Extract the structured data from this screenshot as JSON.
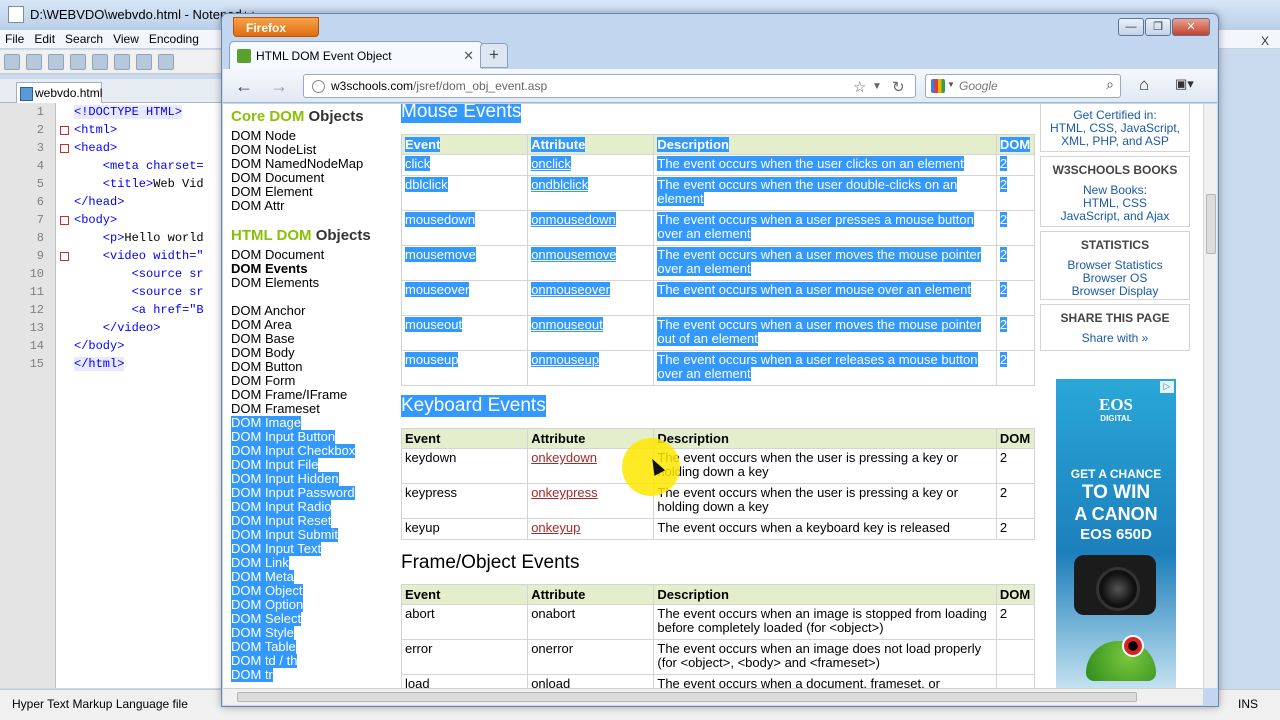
{
  "npp": {
    "title": "D:\\WEBVDO\\webvdo.html - Notepad++",
    "menu": [
      "File",
      "Edit",
      "Search",
      "View",
      "Encoding"
    ],
    "menu_close": "X",
    "tab": "webvdo.html",
    "lines": [
      {
        "n": "1",
        "code": "<!DOCTYPE HTML>",
        "text": ""
      },
      {
        "n": "2",
        "code": "<html>",
        "text": ""
      },
      {
        "n": "3",
        "code": "<head>",
        "text": ""
      },
      {
        "n": "4",
        "code": "    <meta charset=",
        "text": ""
      },
      {
        "n": "5",
        "code": "    <title>",
        "text": "Web Vid"
      },
      {
        "n": "6",
        "code": "</head>",
        "text": ""
      },
      {
        "n": "7",
        "code": "<body>",
        "text": ""
      },
      {
        "n": "8",
        "code": "    <p>",
        "text": "Hello world"
      },
      {
        "n": "9",
        "code": "    <video width=\"",
        "text": ""
      },
      {
        "n": "10",
        "code": "        <source sr",
        "text": ""
      },
      {
        "n": "11",
        "code": "        <source sr",
        "text": ""
      },
      {
        "n": "12",
        "code": "        <a href=\"B",
        "text": ""
      },
      {
        "n": "13",
        "code": "    </video>",
        "text": ""
      },
      {
        "n": "14",
        "code": "</body>",
        "text": ""
      },
      {
        "n": "15",
        "code": "</html>",
        "text": ""
      }
    ],
    "status_left": "Hyper Text Markup Language file",
    "status_right": "INS"
  },
  "ff": {
    "menu_button": "Firefox",
    "tab_title": "HTML DOM Event Object",
    "tab_close": "✕",
    "new_tab": "+",
    "url_domain": "w3schools.com",
    "url_path": "/jsref/dom_obj_event.asp",
    "search_placeholder": "Google"
  },
  "sidebar": {
    "core_em": "Core DOM",
    "core_rest": " Objects",
    "core_items": [
      "DOM Node",
      "DOM NodeList",
      "DOM NamedNodeMap",
      "DOM Document",
      "DOM Element",
      "DOM Attr"
    ],
    "html_em": "HTML DOM",
    "html_rest": " Objects",
    "html_items": [
      {
        "label": "DOM Document",
        "sel": false,
        "bold": false
      },
      {
        "label": "DOM Events",
        "sel": false,
        "bold": true
      },
      {
        "label": "DOM Elements",
        "sel": false,
        "bold": false
      }
    ],
    "obj_items": [
      {
        "label": "DOM Anchor",
        "sel": false
      },
      {
        "label": "DOM Area",
        "sel": false
      },
      {
        "label": "DOM Base",
        "sel": false
      },
      {
        "label": "DOM Body",
        "sel": false
      },
      {
        "label": "DOM Button",
        "sel": false
      },
      {
        "label": "DOM Form",
        "sel": false
      },
      {
        "label": "DOM Frame/IFrame",
        "sel": false
      },
      {
        "label": "DOM Frameset",
        "sel": false
      },
      {
        "label": "DOM Image",
        "sel": true
      },
      {
        "label": "DOM Input Button",
        "sel": true
      },
      {
        "label": "DOM Input Checkbox",
        "sel": true
      },
      {
        "label": "DOM Input File",
        "sel": true
      },
      {
        "label": "DOM Input Hidden",
        "sel": true
      },
      {
        "label": "DOM Input Password",
        "sel": true
      },
      {
        "label": "DOM Input Radio",
        "sel": true
      },
      {
        "label": "DOM Input Reset",
        "sel": true
      },
      {
        "label": "DOM Input Submit",
        "sel": true
      },
      {
        "label": "DOM Input Text",
        "sel": true
      },
      {
        "label": "DOM Link",
        "sel": true
      },
      {
        "label": "DOM Meta",
        "sel": true
      },
      {
        "label": "DOM Object",
        "sel": true
      },
      {
        "label": "DOM Option",
        "sel": true
      },
      {
        "label": "DOM Select",
        "sel": true
      },
      {
        "label": "DOM Style",
        "sel": true
      },
      {
        "label": "DOM Table",
        "sel": true
      },
      {
        "label": "DOM td / th",
        "sel": true
      },
      {
        "label": "DOM tr",
        "sel": true
      }
    ]
  },
  "headers": [
    "Event",
    "Attribute",
    "Description",
    "DOM"
  ],
  "mouse": {
    "title": "Mouse Events",
    "rows": [
      [
        "click",
        "onclick",
        "The event occurs when the user clicks on an element",
        "2"
      ],
      [
        "dblclick",
        "ondblclick",
        "The event occurs when the user double-clicks on an element",
        "2"
      ],
      [
        "mousedown",
        "onmousedown",
        "The event occurs when a user presses a mouse button over an element",
        "2"
      ],
      [
        "mousemove",
        "onmousemove",
        "The event occurs when a user moves the mouse pointer over an element",
        "2"
      ],
      [
        "mouseover",
        "onmouseover",
        "The event occurs when a user mouse over an element",
        "2"
      ],
      [
        "mouseout",
        "onmouseout",
        "The event occurs when a user moves the mouse pointer out of an element",
        "2"
      ],
      [
        "mouseup",
        "onmouseup",
        "The event occurs when a user releases a mouse button over an element",
        "2"
      ]
    ]
  },
  "keyboard": {
    "title": "Keyboard Events",
    "rows": [
      [
        "keydown",
        "onkeydown",
        "The event occurs when the user is pressing a key or holding down a key",
        "2"
      ],
      [
        "keypress",
        "onkeypress",
        "The event occurs when the user is pressing a key or holding down a key",
        "2"
      ],
      [
        "keyup",
        "onkeyup",
        "The event occurs when a keyboard key is released",
        "2"
      ]
    ]
  },
  "frame": {
    "title": "Frame/Object Events",
    "rows": [
      [
        "abort",
        "onabort",
        "The event occurs when an image is stopped from loading before completely loaded (for <object>)",
        "2"
      ],
      [
        "error",
        "onerror",
        "The event occurs when an image does not load properly (for <object>, <body> and <frameset>)",
        ""
      ],
      [
        "load",
        "onload",
        "The event occurs when a document, frameset, or",
        ""
      ]
    ]
  },
  "right": {
    "cert_title": "Get Certified in:",
    "cert_text": "HTML, CSS, JavaScript, XML, PHP, and ASP",
    "books_title": "W3SCHOOLS BOOKS",
    "books_lines": [
      "New Books:",
      "HTML, CSS",
      "JavaScript, and Ajax"
    ],
    "stats_title": "STATISTICS",
    "stats_lines": [
      "Browser Statistics",
      "Browser OS",
      "Browser Display"
    ],
    "share_title": "SHARE THIS PAGE",
    "share_link": "Share with »"
  },
  "ad": {
    "brand": "EOS",
    "brand_sub": "DIGITAL",
    "line1": "GET A CHANCE",
    "line2": "TO WIN",
    "line3": "A CANON",
    "line4": "EOS 650D"
  }
}
